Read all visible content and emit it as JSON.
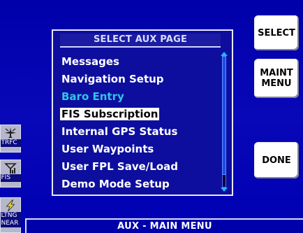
{
  "softkeys": {
    "select": "SELECT",
    "maint_line1": "MAINT",
    "maint_line2": "MENU",
    "done": "DONE"
  },
  "panel": {
    "title": "SELECT AUX PAGE",
    "items": [
      {
        "label": "Messages",
        "state": "normal"
      },
      {
        "label": "Navigation Setup",
        "state": "normal"
      },
      {
        "label": "Baro Entry",
        "state": "cyan"
      },
      {
        "label": "FIS Subscription",
        "state": "selected"
      },
      {
        "label": "Internal GPS Status",
        "state": "normal"
      },
      {
        "label": "User Waypoints",
        "state": "normal"
      },
      {
        "label": "User FPL Save/Load",
        "state": "normal"
      },
      {
        "label": "Demo Mode Setup",
        "state": "normal"
      }
    ]
  },
  "side_icons": {
    "trfc": {
      "label": "TRFC",
      "icon": "traffic-icon"
    },
    "fis": {
      "label": "FIS",
      "icon": "fis-antenna-icon"
    },
    "ltng": {
      "label_line1": "LTNG",
      "label_line2": "NEAR",
      "icon": "lightning-icon"
    }
  },
  "bottom_bar": {
    "label": "AUX - MAIN MENU"
  },
  "colors": {
    "background": "#0000aa",
    "highlight": "#ffffff",
    "cyan_text": "#2fc6e6",
    "scroll": "#1fb6ff"
  }
}
